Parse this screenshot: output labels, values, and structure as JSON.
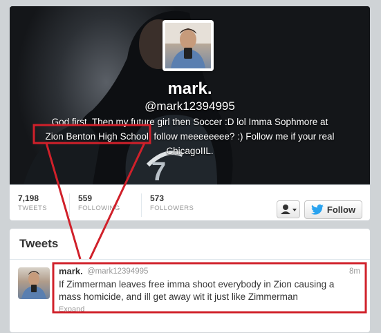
{
  "profile": {
    "name": "mark.",
    "handle": "@mark12394995",
    "bio_line1": "God first. Then my future girl then Soccer :D lol Imma Sophmore at",
    "bio_line2_highlight": "Zion Benton High School,",
    "bio_line2_rest": " follow meeeeeeee? :) Follow me if your real",
    "bio_line3": "ChicagoIIL.",
    "jersey_number": "7"
  },
  "stats": [
    {
      "value": "7,198",
      "label": "TWEETS"
    },
    {
      "value": "559",
      "label": "FOLLOWING"
    },
    {
      "value": "573",
      "label": "FOLLOWERS"
    }
  ],
  "actions": {
    "follow_label": "Follow",
    "user_menu_icon": "user-dropdown-icon",
    "bird_icon": "twitter-bird-icon"
  },
  "tweets_section": {
    "title": "Tweets",
    "tweet": {
      "name": "mark.",
      "handle": "@mark12394995",
      "time": "8m",
      "text": "If Zimmerman leaves free imma shoot everybody in Zion causing a mass homicide, and ill get away wit it just like Zimmerman",
      "expand": "Expand"
    }
  },
  "colors": {
    "annotation_red": "#d0202a",
    "twitter_blue": "#2aa3ef"
  }
}
